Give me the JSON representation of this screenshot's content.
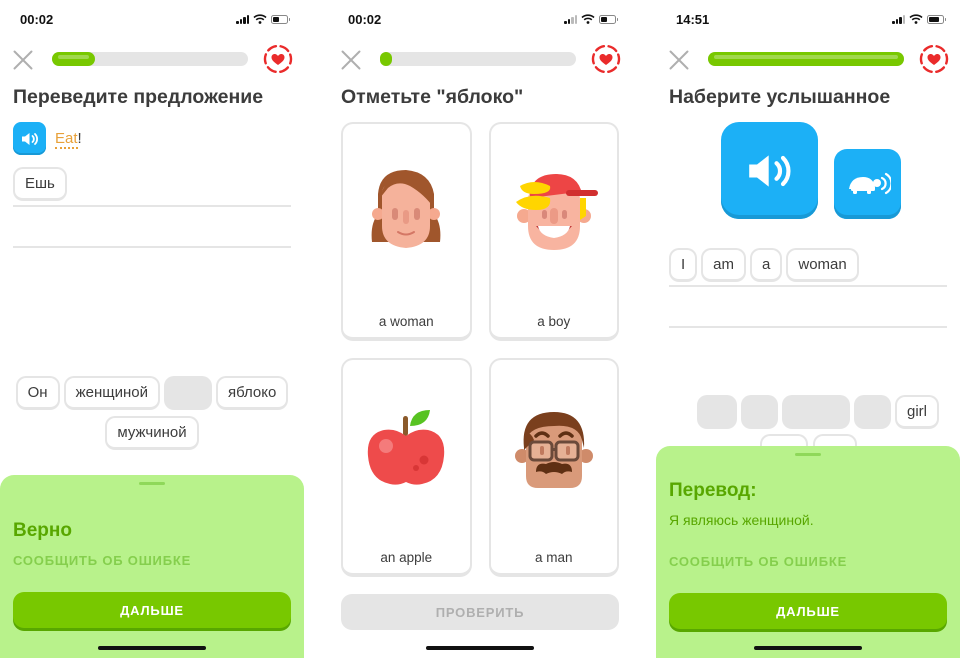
{
  "colors": {
    "accent_green": "#78c800",
    "dark_green": "#58a700",
    "sheet_green": "#b8f28b",
    "audio_blue": "#1cb0f6",
    "heart_red": "#ea2b2b",
    "track_gray": "#e5e5e5"
  },
  "screens": [
    {
      "status": {
        "time": "00:02"
      },
      "progress_fraction": 0.22,
      "title": "Переведите предложение",
      "prompt": {
        "icon": "speaker-icon",
        "word": "Eat",
        "punct": "!"
      },
      "answer_tiles": [
        "Ешь"
      ],
      "word_bank": [
        {
          "label": "Он",
          "used": false
        },
        {
          "label": "женщиной",
          "used": false
        },
        {
          "label": "Ешь",
          "used": true
        },
        {
          "label": "яблоко",
          "used": false
        },
        {
          "label": "мужчиной",
          "used": false
        }
      ],
      "sheet": {
        "headline": "Верно",
        "report": "СООБЩИТЬ ОБ ОШИБКЕ",
        "continue": "ДАЛЬШЕ"
      }
    },
    {
      "status": {
        "time": "00:02"
      },
      "progress_fraction": 0.06,
      "title": "Отметьте \"яблоко\"",
      "cards": [
        {
          "label": "a woman",
          "image": "woman-illustration"
        },
        {
          "label": "a boy",
          "image": "boy-illustration"
        },
        {
          "label": "an apple",
          "image": "apple-illustration"
        },
        {
          "label": "a man",
          "image": "man-illustration"
        }
      ],
      "check": "ПРОВЕРИТЬ"
    },
    {
      "status": {
        "time": "14:51"
      },
      "progress_fraction": 1.0,
      "title": "Наберите услышанное",
      "audio": {
        "normal": "speaker-icon",
        "slow": "turtle-speaker-icon"
      },
      "answer_tiles": [
        "I",
        "am",
        "a",
        "woman"
      ],
      "word_bank_row1": [
        {
          "label": "I",
          "used": true
        },
        {
          "label": "am",
          "used": true
        },
        {
          "label": "woman",
          "used": true
        },
        {
          "label": "a",
          "used": true
        },
        {
          "label": "girl",
          "used": false
        }
      ],
      "sheet": {
        "headline": "Перевод:",
        "translation": "Я являюсь женщиной.",
        "report": "СООБЩИТЬ ОБ ОШИБКЕ",
        "continue": "ДАЛЬШЕ"
      }
    }
  ]
}
